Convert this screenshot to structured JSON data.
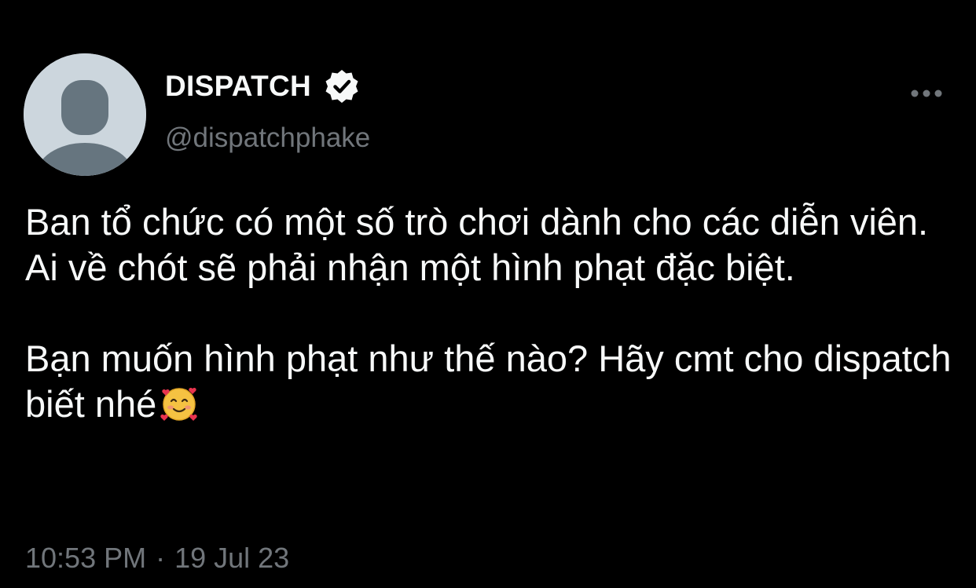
{
  "author": {
    "display_name": "DISPATCH",
    "handle": "@dispatchphake",
    "verified": true,
    "avatar_icon": "default-avatar-icon",
    "verified_icon": "verified-badge-icon"
  },
  "menu": {
    "icon": "more-options-icon"
  },
  "tweet": {
    "paragraphs": [
      "Ban tổ chức có một số trò chơi dành cho các diễn viên. Ai về chót sẽ phải nhận một hình phạt đặc biệt.",
      "Bạn muốn hình phạt như thế nào? Hãy cmt cho dispatch biết nhé"
    ],
    "emoji": "smiling-face-with-hearts-emoji",
    "time": "10:53 PM",
    "separator": "·",
    "date": "19 Jul 23"
  },
  "colors": {
    "background": "#000000",
    "text_primary": "#f7f9f9",
    "text_secondary": "#71767b",
    "avatar_bg": "#ccd6dd",
    "avatar_fg": "#66757f"
  }
}
